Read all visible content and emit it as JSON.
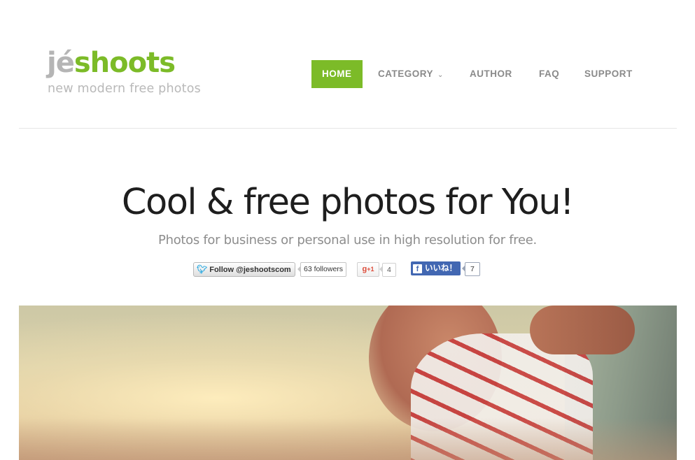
{
  "logo": {
    "part1": "jé",
    "part2": "shoots",
    "tagline": "new modern free photos"
  },
  "nav": {
    "items": [
      {
        "label": "HOME",
        "active": true
      },
      {
        "label": "CATEGORY",
        "dropdown": true
      },
      {
        "label": "AUTHOR"
      },
      {
        "label": "FAQ"
      },
      {
        "label": "SUPPORT"
      }
    ]
  },
  "hero": {
    "title": "Cool & free photos for You!",
    "subtitle": "Photos for business or personal use in high resolution for free."
  },
  "social": {
    "twitter": {
      "label": "Follow @jeshootscom",
      "count": "63 followers"
    },
    "gplus": {
      "label": "+1",
      "count": "4"
    },
    "facebook": {
      "label": "いいね！",
      "count": "7"
    }
  },
  "colors": {
    "brand_green": "#7cbb28",
    "facebook_blue": "#4267b2",
    "twitter_blue": "#2aa9e0",
    "gplus_red": "#dd4b39"
  },
  "icons": {
    "twitter": "twitter-bird-icon",
    "gplus": "google-plus-icon",
    "facebook": "facebook-f-icon",
    "dropdown": "chevron-down-icon"
  }
}
